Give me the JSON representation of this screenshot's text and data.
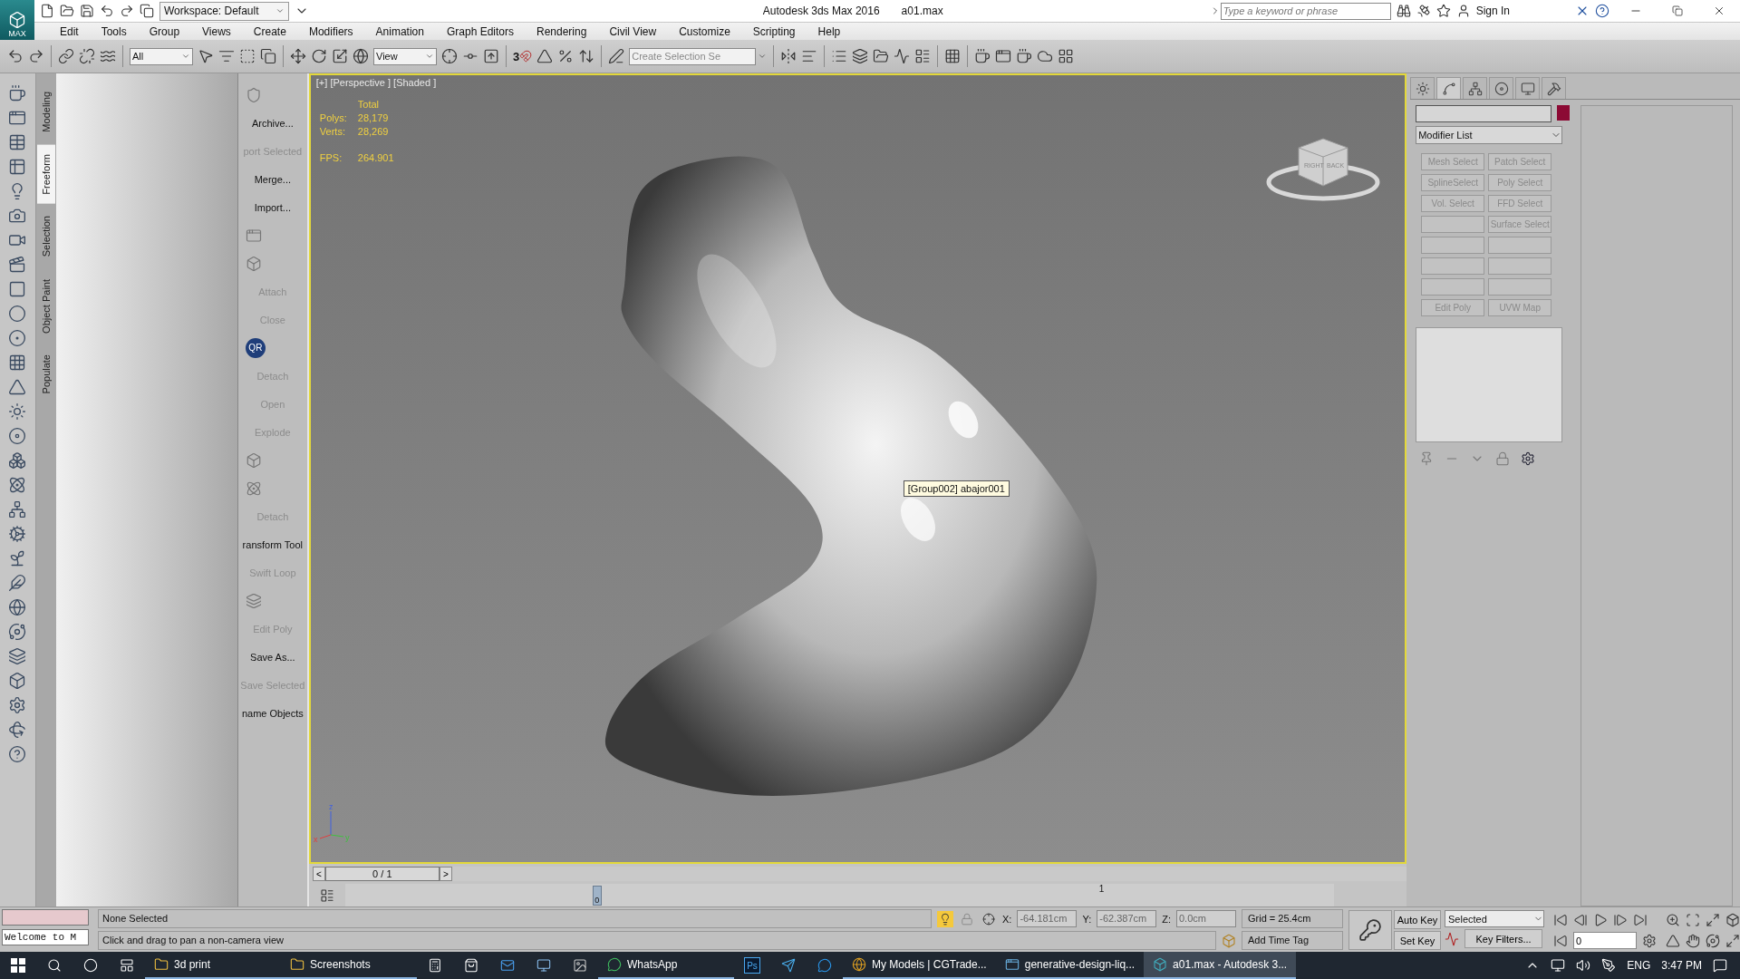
{
  "title_bar": {
    "app_button": "MAX",
    "workspace": "Workspace: Default",
    "title": "Autodesk 3ds Max 2016",
    "file": "a01.max",
    "search": {
      "placeholder": "Type a keyword or phrase"
    },
    "sign_in": "Sign In"
  },
  "menu": [
    "Edit",
    "Tools",
    "Group",
    "Views",
    "Create",
    "Modifiers",
    "Animation",
    "Graph Editors",
    "Rendering",
    "Civil View",
    "Customize",
    "Scripting",
    "Help"
  ],
  "main_toolbar": {
    "selection_filter": "All",
    "reference_system": "View",
    "snap_dimension": "3",
    "selection_set": {
      "placeholder": "Create Selection Se"
    }
  },
  "ribbon_tabs": [
    {
      "label": "Modeling",
      "selected": false
    },
    {
      "label": "Freeform",
      "selected": true
    },
    {
      "label": "Selection",
      "selected": false
    },
    {
      "label": "Object Paint",
      "selected": false
    },
    {
      "label": "Populate",
      "selected": false
    }
  ],
  "quad_column": [
    {
      "kind": "icon"
    },
    {
      "kind": "command",
      "label": "Archive...",
      "disabled": false
    },
    {
      "kind": "command",
      "label": "port Selected",
      "disabled": true
    },
    {
      "kind": "command",
      "label": "Merge...",
      "disabled": false
    },
    {
      "kind": "command",
      "label": "Import...",
      "disabled": false
    },
    {
      "kind": "icon"
    },
    {
      "kind": "icon"
    },
    {
      "kind": "command",
      "label": "Attach",
      "disabled": true
    },
    {
      "kind": "command",
      "label": "Close",
      "disabled": true
    },
    {
      "kind": "badge",
      "label": "QR"
    },
    {
      "kind": "command",
      "label": "Detach",
      "disabled": true
    },
    {
      "kind": "command",
      "label": "Open",
      "disabled": true
    },
    {
      "kind": "command",
      "label": "Explode",
      "disabled": true
    },
    {
      "kind": "icon"
    },
    {
      "kind": "icon"
    },
    {
      "kind": "command",
      "label": "Detach",
      "disabled": true
    },
    {
      "kind": "command",
      "label": "ransform Tool",
      "disabled": false
    },
    {
      "kind": "command",
      "label": "Swift Loop",
      "disabled": true
    },
    {
      "kind": "icon"
    },
    {
      "kind": "command",
      "label": "Edit Poly",
      "disabled": true
    },
    {
      "kind": "command",
      "label": "Save As...",
      "disabled": false
    },
    {
      "kind": "command",
      "label": "Save Selected",
      "disabled": true
    },
    {
      "kind": "command",
      "label": "name Objects",
      "disabled": false
    }
  ],
  "viewport": {
    "label": "[+] [Perspective ] [Shaded ]",
    "stats_heading": "Total",
    "stats": [
      {
        "name": "Polys:",
        "value": "28,179"
      },
      {
        "name": "Verts:",
        "value": "28,269"
      },
      {
        "name": "FPS:",
        "value": "264.901"
      }
    ],
    "tooltip": "[Group002] abajor001",
    "viewcube_faces": [
      "RIGHT",
      "BACK"
    ],
    "axes": [
      "z",
      "x",
      "y"
    ]
  },
  "time_slider": {
    "prev": "<",
    "position": "0 / 1",
    "next": ">"
  },
  "track_bar": {
    "thumb": "0",
    "tick": "1"
  },
  "command_panel": {
    "tabs": [
      {
        "selected": false
      },
      {
        "selected": true
      },
      {
        "selected": false
      },
      {
        "selected": false
      },
      {
        "selected": false
      },
      {
        "selected": false
      }
    ],
    "swatch": {
      "color": "#8c0a34"
    },
    "modifier_list": "Modifier List",
    "modifier_buttons": [
      {
        "kind": "labeled",
        "label": "Mesh Select"
      },
      {
        "kind": "labeled",
        "label": "Patch Select"
      },
      {
        "kind": "labeled",
        "label": "SplineSelect"
      },
      {
        "kind": "labeled",
        "label": "Poly Select"
      },
      {
        "kind": "labeled",
        "label": "Vol. Select"
      },
      {
        "kind": "labeled",
        "label": "FFD Select"
      },
      {
        "kind": "blank"
      },
      {
        "kind": "labeled",
        "label": "Surface Select"
      },
      {
        "kind": "blank"
      },
      {
        "kind": "blank"
      },
      {
        "kind": "blank"
      },
      {
        "kind": "blank"
      },
      {
        "kind": "blank"
      },
      {
        "kind": "blank"
      },
      {
        "kind": "labeled",
        "label": "Edit Poly"
      },
      {
        "kind": "labeled",
        "label": "UVW Map"
      }
    ]
  },
  "status_bar": {
    "listener": "Welcome to M",
    "selection": "None Selected",
    "prompt": "Click and drag to pan a non-camera view",
    "toggles": [
      {
        "on": true
      },
      {
        "on": false
      },
      {
        "on": false
      }
    ],
    "coords": [
      {
        "axis": "X:",
        "value": "-64.181cm"
      },
      {
        "axis": "Y:",
        "value": "-62.387cm"
      },
      {
        "axis": "Z:",
        "value": "0.0cm"
      }
    ],
    "grid": "Grid = 25.4cm",
    "time_tag": "Add Time Tag",
    "auto_key": "Auto Key",
    "set_key": "Set Key",
    "key_set": "Selected",
    "key_filters": "Key Filters...",
    "frame": "0"
  },
  "taskbar": {
    "apps": [
      {
        "label": "3d print",
        "selected": false
      },
      {
        "label": "Screenshots",
        "selected": false
      },
      {
        "label": "WhatsApp",
        "selected": false
      },
      {
        "label": "My Models | CGTrade...",
        "selected": false
      },
      {
        "label": "generative-design-liq...",
        "selected": false
      },
      {
        "label": "a01.max - Autodesk 3...",
        "selected": true
      }
    ],
    "ps_badge": "Ps",
    "language": "ENG",
    "time": "3:47 PM"
  }
}
